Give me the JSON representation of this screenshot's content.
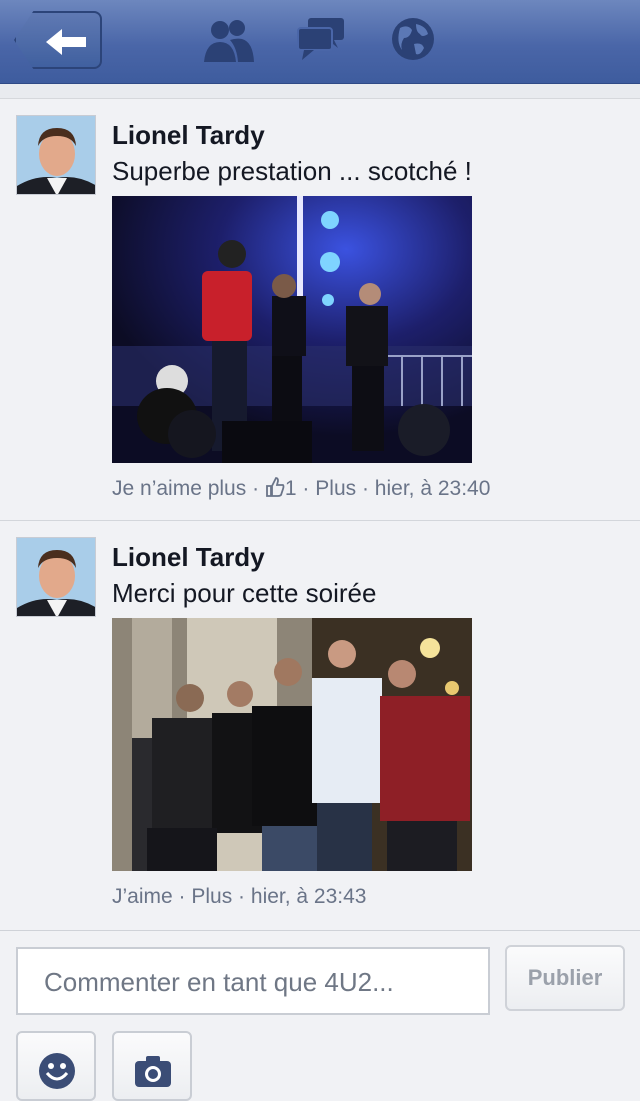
{
  "navbar": {
    "back_icon": "back-arrow-icon",
    "icons": [
      "friends-icon",
      "messages-icon",
      "globe-icon"
    ]
  },
  "posts": [
    {
      "author": "Lionel Tardy",
      "text": "Superbe prestation ... scotché !",
      "photo": "concert-stage-photo",
      "actions": {
        "like_label": "Je n’aime plus",
        "sep1": " · ",
        "like_count": "1",
        "sep2": " · ",
        "more_label": "Plus",
        "sep3": " · ",
        "timestamp": "hier, à 23:40"
      }
    },
    {
      "author": "Lionel Tardy",
      "text": "Merci pour cette soirée",
      "photo": "group-photo",
      "actions": {
        "like_label": "J’aime",
        "sep1": " · ",
        "more_label": "Plus",
        "sep2": " · ",
        "timestamp": "hier, à 23:43"
      }
    }
  ],
  "composer": {
    "placeholder": "Commenter en tant que 4U2...",
    "publish_label": "Publier",
    "tools": [
      "smiley-icon",
      "camera-icon"
    ]
  },
  "colors": {
    "navbar": "#4a66a8",
    "meta_text": "#6a7488",
    "background": "#f1f2f5"
  }
}
